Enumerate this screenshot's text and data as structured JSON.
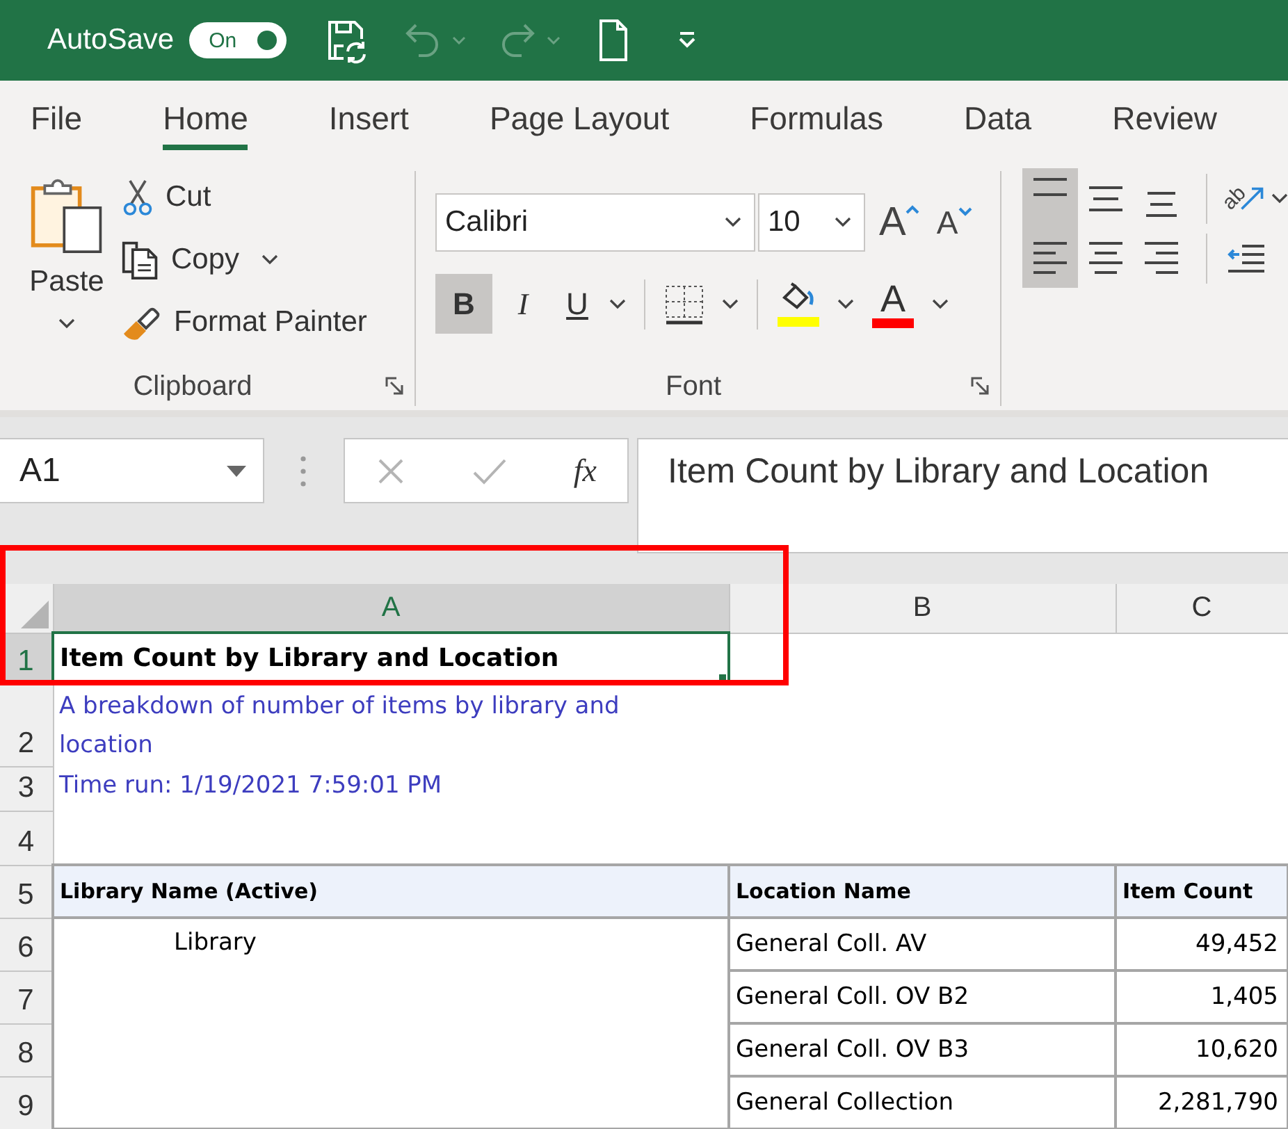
{
  "title_bar": {
    "autosave_label": "AutoSave",
    "autosave": {
      "label": "On",
      "on": true
    },
    "quick_access": [
      {
        "kind": "save",
        "disabled": false
      },
      {
        "kind": "undo",
        "disabled": true
      },
      {
        "kind": "redo",
        "disabled": true
      },
      {
        "kind": "new",
        "disabled": false
      },
      {
        "kind": "customize",
        "disabled": false
      }
    ]
  },
  "tabs": [
    {
      "label": "File",
      "selected": false
    },
    {
      "label": "Home",
      "selected": true
    },
    {
      "label": "Insert",
      "selected": false
    },
    {
      "label": "Page Layout",
      "selected": false
    },
    {
      "label": "Formulas",
      "selected": false
    },
    {
      "label": "Data",
      "selected": false
    },
    {
      "label": "Review",
      "selected": false
    }
  ],
  "ribbon": {
    "clipboard": {
      "label": "Clipboard",
      "paste": "Paste",
      "commands": [
        {
          "kind": "cut",
          "label": "Cut"
        },
        {
          "kind": "copy",
          "label": "Copy"
        },
        {
          "kind": "format_painter",
          "label": "Format Painter"
        }
      ]
    },
    "font": {
      "label": "Font",
      "font_name": "Calibri",
      "font_size": "10",
      "grow": "A",
      "shrink": "A",
      "styles": [
        {
          "kind": "bold",
          "label": "B",
          "selected": true
        },
        {
          "kind": "italic",
          "label": "I",
          "selected": false
        },
        {
          "kind": "underline",
          "label": "U",
          "selected": false
        }
      ],
      "fill_color": {
        "color": "#ffff00"
      },
      "font_color": {
        "label": "A",
        "color": "#ff0000"
      }
    },
    "alignment": {
      "vertical": [
        {
          "kind": "top",
          "selected": true
        },
        {
          "kind": "middle",
          "selected": false
        },
        {
          "kind": "bottom",
          "selected": false
        }
      ],
      "horizontal": [
        {
          "kind": "left",
          "selected": true
        },
        {
          "kind": "center",
          "selected": false
        },
        {
          "kind": "right",
          "selected": false
        }
      ],
      "orientation": "ab"
    }
  },
  "formula_bar": {
    "name_box": "A1",
    "buttons": [
      {
        "kind": "cancel",
        "disabled": true
      },
      {
        "kind": "enter",
        "disabled": true
      },
      {
        "kind": "function",
        "label": "fx",
        "disabled": false
      }
    ],
    "value": "Item Count by Library and Location"
  },
  "sheet": {
    "columns": [
      {
        "label": "A",
        "selected": true
      },
      {
        "label": "B",
        "selected": false
      },
      {
        "label": "C",
        "selected": false
      }
    ],
    "row_headers": [
      {
        "label": "1",
        "selected": true
      },
      {
        "label": "2",
        "selected": false
      },
      {
        "label": "3",
        "selected": false
      },
      {
        "label": "4",
        "selected": false
      },
      {
        "label": "5",
        "selected": false
      },
      {
        "label": "6",
        "selected": false
      },
      {
        "label": "7",
        "selected": false
      },
      {
        "label": "8",
        "selected": false
      },
      {
        "label": "9",
        "selected": false
      }
    ],
    "title": {
      "text": "Item Count by Library and Location",
      "selected": true
    },
    "subtitle": "A breakdown of number of items by library and location",
    "time_run": "Time run: 1/19/2021 7:59:01 PM",
    "table": {
      "columns": [
        "Library Name (Active)",
        "Location Name",
        "Item Count"
      ],
      "library": "Library",
      "rows": [
        {
          "location": "General Coll. AV",
          "count": "49,452"
        },
        {
          "location": "General Coll. OV B2",
          "count": "1,405"
        },
        {
          "location": "General Coll. OV B3",
          "count": "10,620"
        },
        {
          "location": "General Collection",
          "count": "2,281,790"
        }
      ]
    }
  },
  "annotation": {
    "kind": "frame"
  }
}
